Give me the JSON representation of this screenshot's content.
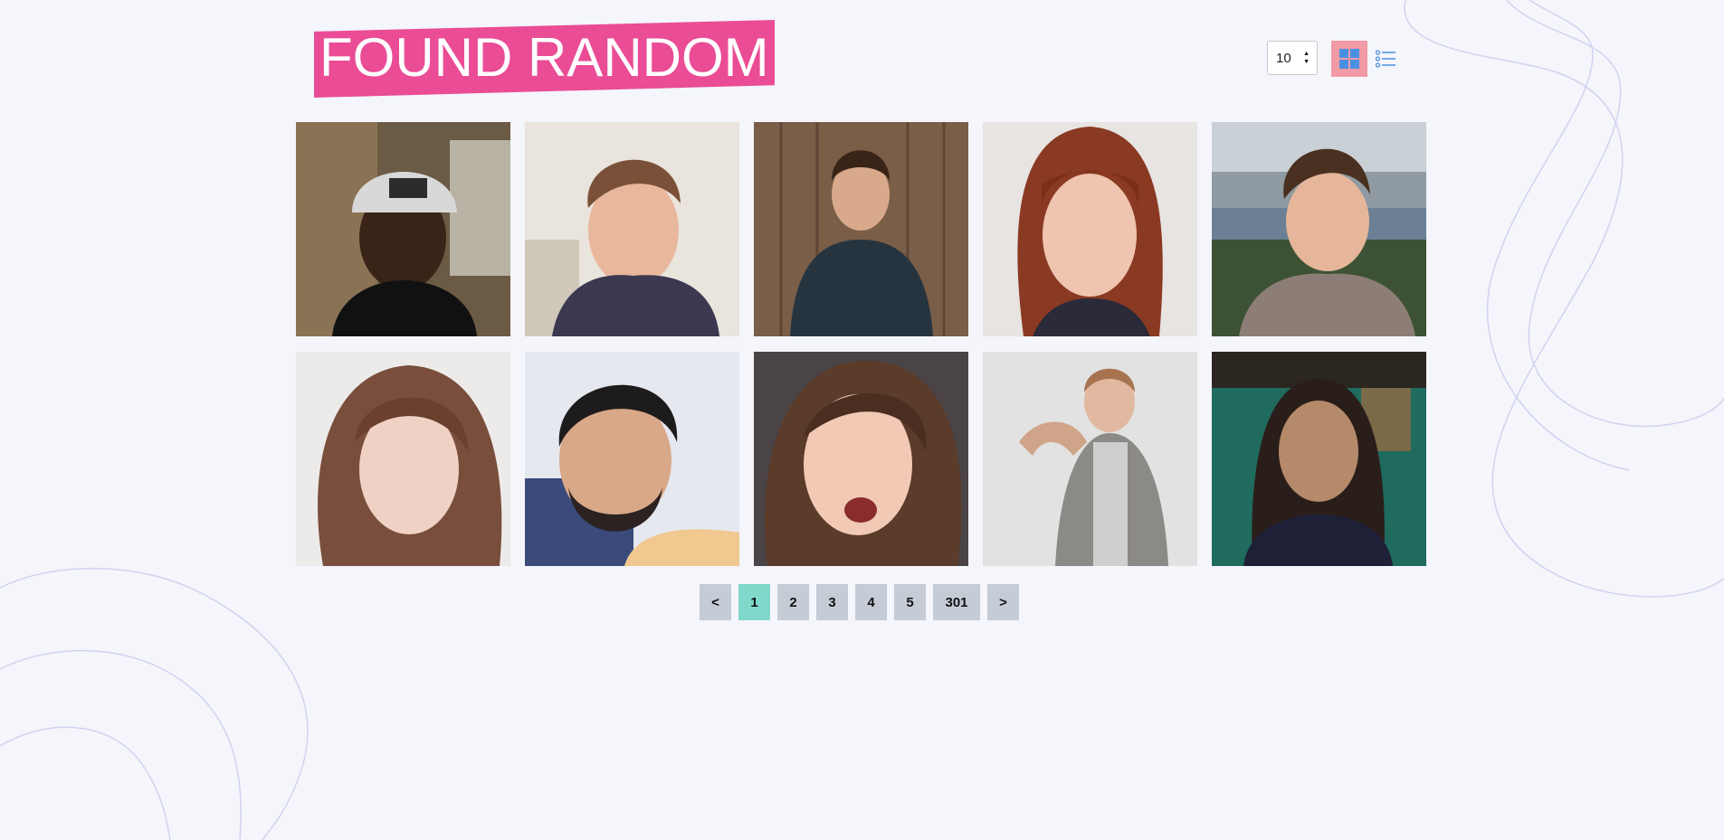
{
  "header": {
    "title": "FOUND RANDOM",
    "title_bg_color": "#ea4c95"
  },
  "controls": {
    "per_page_value": "10",
    "grid_view_icon": "grid-view-icon",
    "list_view_icon": "list-view-icon",
    "grid_active_color": "#f29aa6",
    "icon_color": "#4a90e2"
  },
  "gallery": {
    "items": [
      {
        "icon": "profile-photo"
      },
      {
        "icon": "profile-photo"
      },
      {
        "icon": "profile-photo"
      },
      {
        "icon": "profile-photo"
      },
      {
        "icon": "profile-photo"
      },
      {
        "icon": "profile-photo"
      },
      {
        "icon": "profile-photo"
      },
      {
        "icon": "profile-photo"
      },
      {
        "icon": "profile-photo"
      },
      {
        "icon": "profile-photo"
      }
    ]
  },
  "pagination": {
    "prev_label": "<",
    "next_label": ">",
    "pages": [
      "1",
      "2",
      "3",
      "4",
      "5",
      "301"
    ],
    "active_page": "1",
    "active_color": "#7fd8c9",
    "button_color": "#c5ccd6"
  }
}
